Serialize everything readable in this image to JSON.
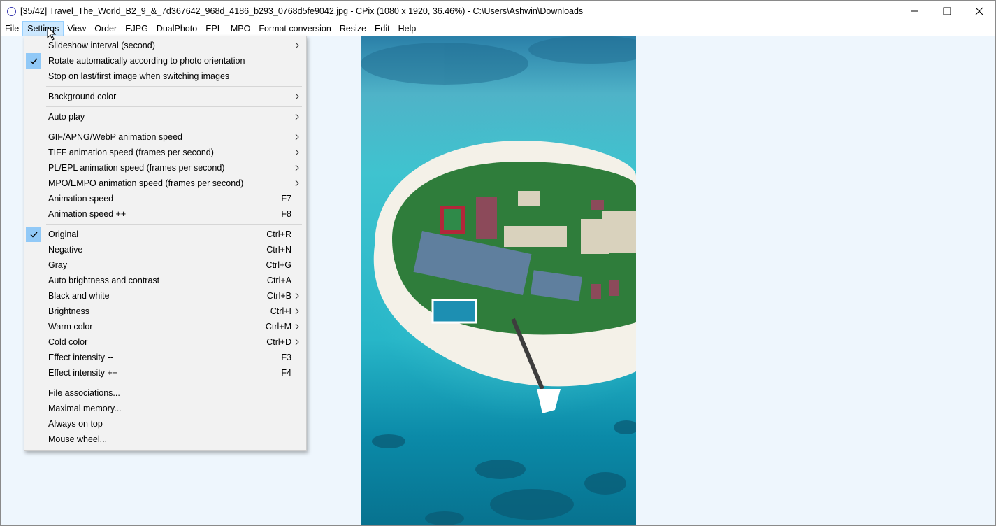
{
  "window": {
    "title": "[35/42] Travel_The_World_B2_9_&_7d367642_968d_4186_b293_0768d5fe9042.jpg - CPix (1080 x 1920, 36.46%) - C:\\Users\\Ashwin\\Downloads",
    "app_icon": "cpix-ring-icon",
    "controls": [
      "minimize-icon",
      "maximize-icon",
      "close-icon"
    ]
  },
  "menubar": {
    "items": [
      "File",
      "Settings",
      "View",
      "Order",
      "EJPG",
      "DualPhoto",
      "EPL",
      "MPO",
      "Format conversion",
      "Resize",
      "Edit",
      "Help"
    ],
    "active": "Settings"
  },
  "settings_menu": {
    "items": [
      {
        "label": "Slideshow interval (second)",
        "submenu": true
      },
      {
        "label": "Rotate automatically according to photo orientation",
        "checked": true
      },
      {
        "label": "Stop on last/first image when switching images"
      },
      {
        "separator": true
      },
      {
        "label": "Background color",
        "submenu": true
      },
      {
        "separator": true
      },
      {
        "label": "Auto play",
        "submenu": true
      },
      {
        "separator": true
      },
      {
        "label": "GIF/APNG/WebP animation speed",
        "submenu": true
      },
      {
        "label": "TIFF animation speed (frames per second)",
        "submenu": true
      },
      {
        "label": "PL/EPL animation speed (frames per second)",
        "submenu": true
      },
      {
        "label": "MPO/EMPO animation speed (frames per second)",
        "submenu": true
      },
      {
        "label": "Animation speed --",
        "shortcut": "F7"
      },
      {
        "label": "Animation speed ++",
        "shortcut": "F8"
      },
      {
        "separator": true
      },
      {
        "label": "Original",
        "shortcut": "Ctrl+R",
        "checked": true
      },
      {
        "label": "Negative",
        "shortcut": "Ctrl+N"
      },
      {
        "label": "Gray",
        "shortcut": "Ctrl+G"
      },
      {
        "label": "Auto brightness and contrast",
        "shortcut": "Ctrl+A"
      },
      {
        "label": "Black and white",
        "shortcut": "Ctrl+B",
        "submenu": true
      },
      {
        "label": "Brightness",
        "shortcut": "Ctrl+I",
        "submenu": true
      },
      {
        "label": "Warm color",
        "shortcut": "Ctrl+M",
        "submenu": true
      },
      {
        "label": "Cold color",
        "shortcut": "Ctrl+D",
        "submenu": true
      },
      {
        "label": "Effect intensity --",
        "shortcut": "F3"
      },
      {
        "label": "Effect intensity ++",
        "shortcut": "F4"
      },
      {
        "separator": true
      },
      {
        "label": "File associations..."
      },
      {
        "label": "Maximal memory..."
      },
      {
        "label": "Always on top"
      },
      {
        "label": "Mouse wheel..."
      }
    ]
  },
  "colors": {
    "viewer_background": "#eef6fd",
    "menu_highlight": "#cce8ff",
    "check_background": "#91c9f7"
  }
}
